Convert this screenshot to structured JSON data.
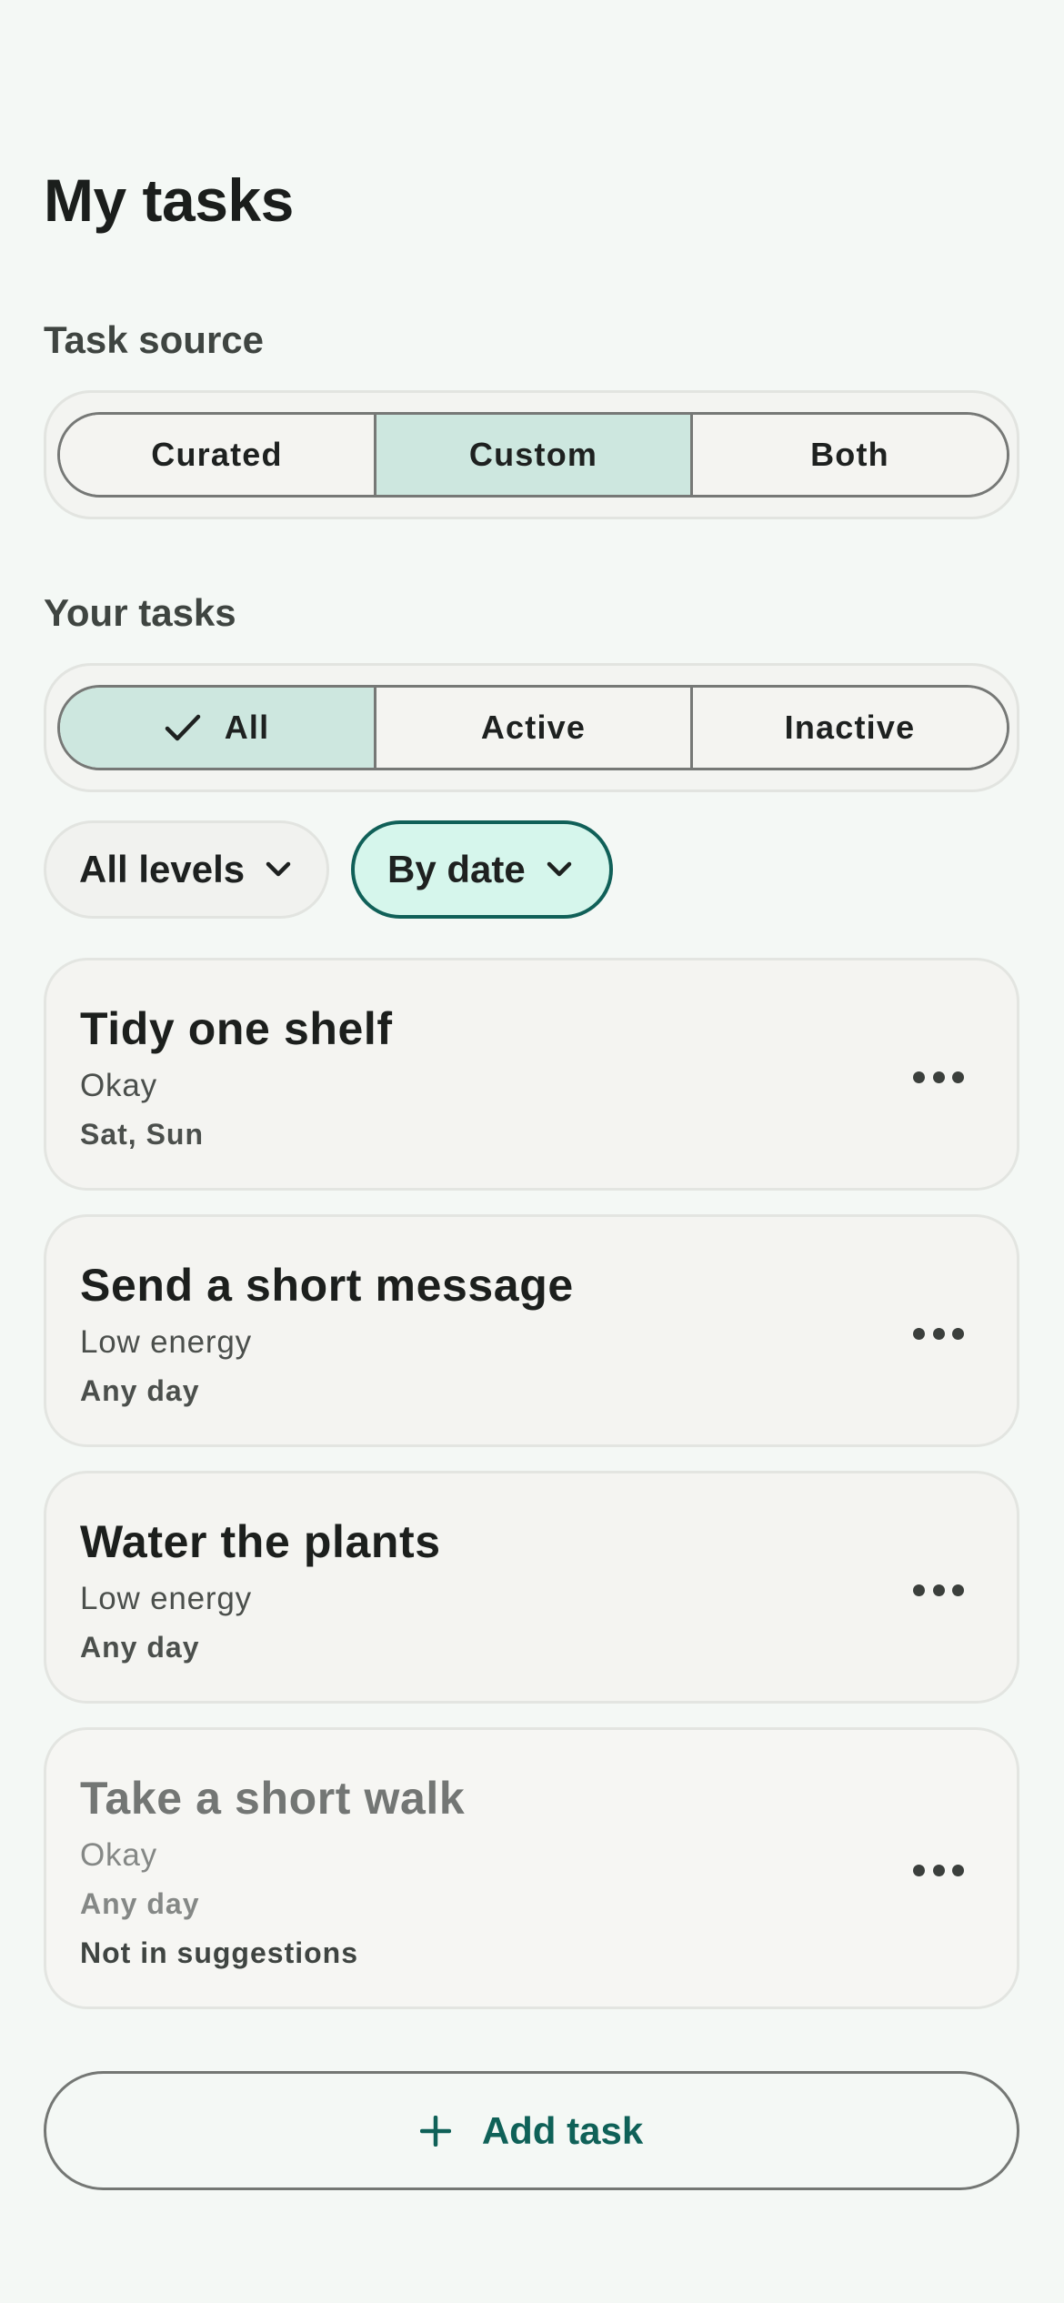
{
  "page": {
    "title": "My tasks"
  },
  "task_source": {
    "label": "Task source",
    "options": [
      "Curated",
      "Custom",
      "Both"
    ],
    "selected": "Custom"
  },
  "your_tasks": {
    "label": "Your tasks",
    "options": [
      "All",
      "Active",
      "Inactive"
    ],
    "selected": "All"
  },
  "filters": {
    "levels": "All levels",
    "sort": "By date"
  },
  "tasks": [
    {
      "title": "Tidy one shelf",
      "energy": "Okay",
      "days": "Sat, Sun",
      "note": ""
    },
    {
      "title": "Send a short message",
      "energy": "Low energy",
      "days": "Any day",
      "note": ""
    },
    {
      "title": "Water the plants",
      "energy": "Low energy",
      "days": "Any day",
      "note": ""
    },
    {
      "title": "Take a short walk",
      "energy": "Okay",
      "days": "Any day",
      "note": "Not in suggestions"
    }
  ],
  "add_button": {
    "label": "Add task"
  },
  "colors": {
    "background": "#f4f8f5",
    "selected_segment": "#cde7df",
    "accent": "#0f6158",
    "sort_chip_fill": "#d6f6ec"
  },
  "icons": {
    "check": "check-icon",
    "chevron": "chevron-down-icon",
    "more": "more-horizontal-icon",
    "plus": "plus-icon"
  }
}
